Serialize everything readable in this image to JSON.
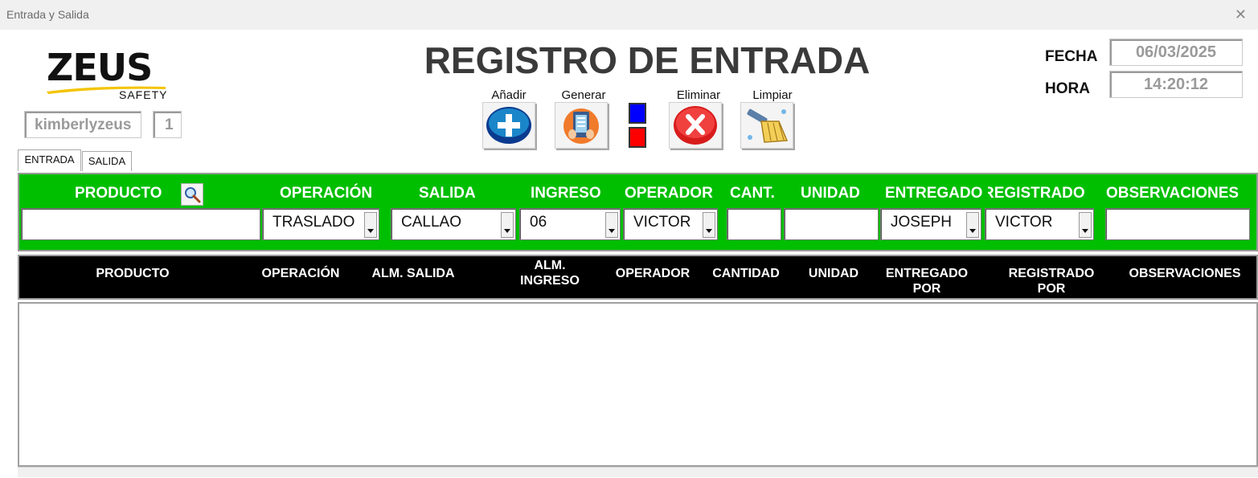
{
  "window": {
    "title": "Entrada y Salida"
  },
  "logo": {
    "brand": "ZEUS",
    "sub": "SAFETY"
  },
  "user": {
    "name": "kimberlyzeus",
    "count": "1"
  },
  "header": {
    "title": "REGISTRO DE ENTRADA"
  },
  "buttons": {
    "add": "Añadir",
    "generate": "Generar",
    "delete": "Eliminar",
    "clear": "Limpiar"
  },
  "datetime": {
    "fecha_label": "FECHA",
    "fecha": "06/03/2025",
    "hora_label": "HORA",
    "hora": "14:20:12"
  },
  "tabs": [
    "ENTRADA",
    "SALIDA"
  ],
  "form": {
    "headers": {
      "producto": "PRODUCTO",
      "operacion": "OPERACIÓN",
      "salida": "SALIDA",
      "ingreso": "INGRESO",
      "operador": "OPERADOR",
      "cant": "CANT.",
      "unidad": "UNIDAD",
      "entregado": "ENTREGADO",
      "registrado": "REGISTRADO",
      "observaciones": "OBSERVACIONES"
    },
    "values": {
      "producto": "",
      "operacion": "TRASLADO",
      "salida": "CALLAO",
      "ingreso": "06",
      "operador": "VICTOR",
      "cant": "",
      "unidad": "",
      "entregado": "JOSEPH",
      "registrado": "VICTOR",
      "observaciones": ""
    }
  },
  "table": {
    "columns": [
      "PRODUCTO",
      "OPERACIÓN",
      "ALM. SALIDA",
      "ALM.\nINGRESO",
      "OPERADOR",
      "CANTIDAD",
      "UNIDAD",
      "ENTREGADO\nPOR",
      "REGISTRADO\nPOR",
      "OBSERVACIONES"
    ],
    "rows": []
  },
  "colors": {
    "green_panel": "#00be00",
    "header_bar": "#000000",
    "indicator_blue": "#0000ff",
    "indicator_red": "#ff0000"
  }
}
